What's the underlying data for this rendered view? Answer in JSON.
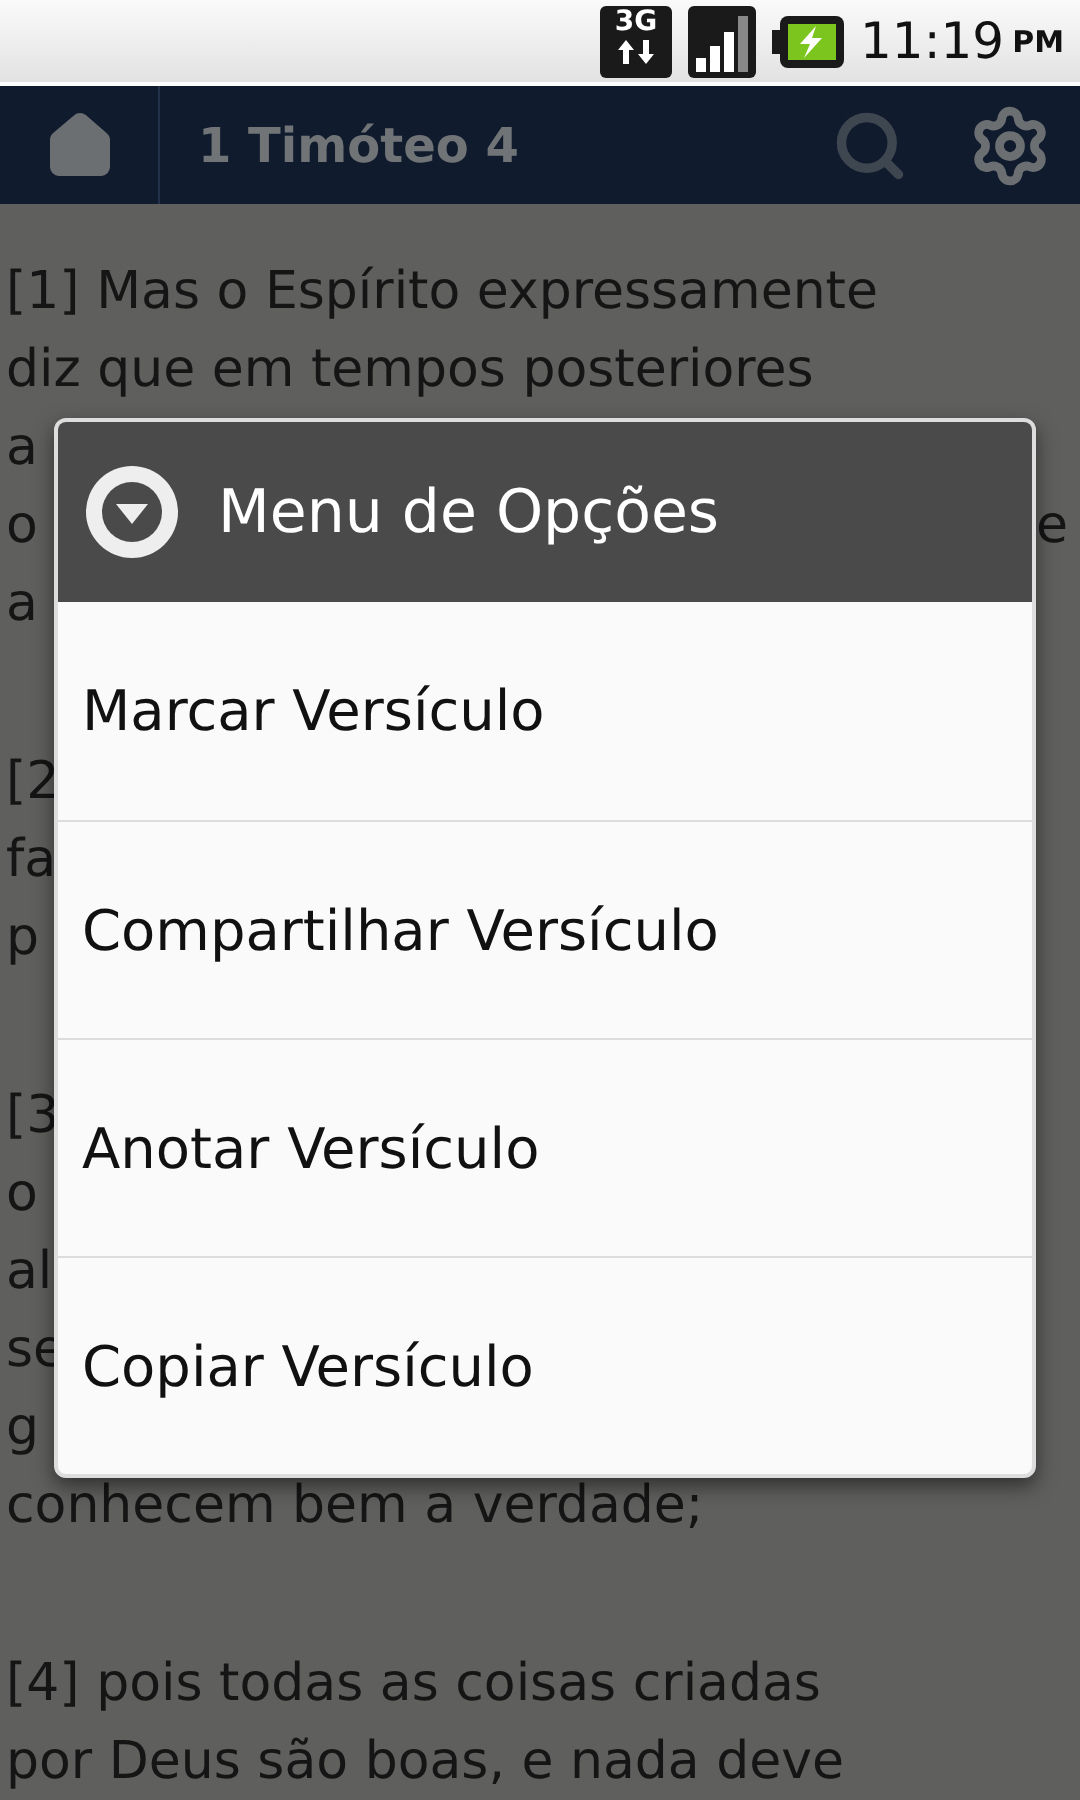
{
  "status_bar": {
    "network": "3G",
    "time": "11:19",
    "period": "PM"
  },
  "toolbar": {
    "title": "1 Timóteo 4"
  },
  "verses": [
    {
      "lines": [
        {
          "left": "[1] Mas o Espírito expressamente"
        },
        {
          "left": "diz que em tempos posteriores"
        },
        {
          "left": "a"
        },
        {
          "left": "o",
          "right": "e"
        },
        {
          "left": "a"
        }
      ]
    },
    {
      "lines": [
        {
          "left": "[2"
        },
        {
          "left": "fa"
        },
        {
          "left": "p"
        }
      ]
    },
    {
      "lines": [
        {
          "left": "[3"
        },
        {
          "left": "o"
        },
        {
          "left": "al"
        },
        {
          "left": "se"
        },
        {
          "left": "g"
        },
        {
          "left": "conhecem bem a verdade;"
        }
      ]
    },
    {
      "lines": [
        {
          "left": "[4] pois todas as coisas criadas"
        },
        {
          "left": "por Deus são boas, e nada deve"
        }
      ]
    }
  ],
  "dialog": {
    "title": "Menu de Opções",
    "items": [
      "Marcar Versículo",
      "Compartilhar Versículo",
      "Anotar Versículo",
      "Copiar Versículo"
    ]
  }
}
